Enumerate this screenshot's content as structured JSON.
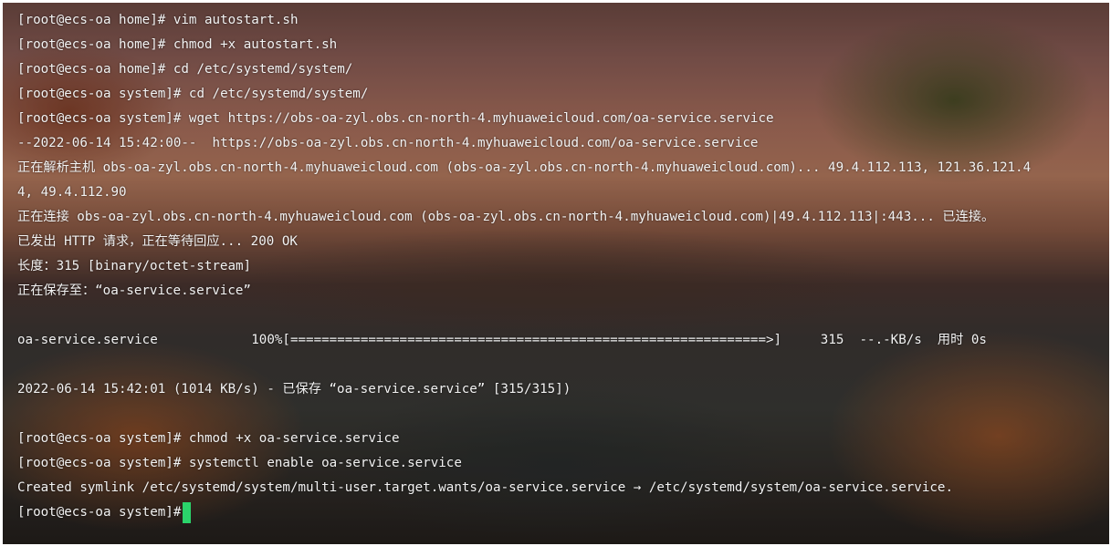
{
  "terminal": {
    "lines": [
      "[root@ecs-oa home]# vim autostart.sh",
      "[root@ecs-oa home]# chmod +x autostart.sh",
      "[root@ecs-oa home]# cd /etc/systemd/system/",
      "[root@ecs-oa system]# cd /etc/systemd/system/",
      "[root@ecs-oa system]# wget https://obs-oa-zyl.obs.cn-north-4.myhuaweicloud.com/oa-service.service",
      "--2022-06-14 15:42:00--  https://obs-oa-zyl.obs.cn-north-4.myhuaweicloud.com/oa-service.service",
      "正在解析主机 obs-oa-zyl.obs.cn-north-4.myhuaweicloud.com (obs-oa-zyl.obs.cn-north-4.myhuaweicloud.com)... 49.4.112.113, 121.36.121.4",
      "4, 49.4.112.90",
      "正在连接 obs-oa-zyl.obs.cn-north-4.myhuaweicloud.com (obs-oa-zyl.obs.cn-north-4.myhuaweicloud.com)|49.4.112.113|:443... 已连接。",
      "已发出 HTTP 请求，正在等待回应... 200 OK",
      "长度：315 [binary/octet-stream]",
      "正在保存至：“oa-service.service”",
      "",
      "oa-service.service            100%[=============================================================>]     315  --.-KB/s  用时 0s",
      "",
      "2022-06-14 15:42:01 (1014 KB/s) - 已保存 “oa-service.service” [315/315])",
      "",
      "[root@ecs-oa system]# chmod +x oa-service.service",
      "[root@ecs-oa system]# systemctl enable oa-service.service",
      "Created symlink /etc/systemd/system/multi-user.target.wants/oa-service.service → /etc/systemd/system/oa-service.service.",
      "[root@ecs-oa system]#"
    ],
    "cursor_color": "#2bd36b"
  }
}
